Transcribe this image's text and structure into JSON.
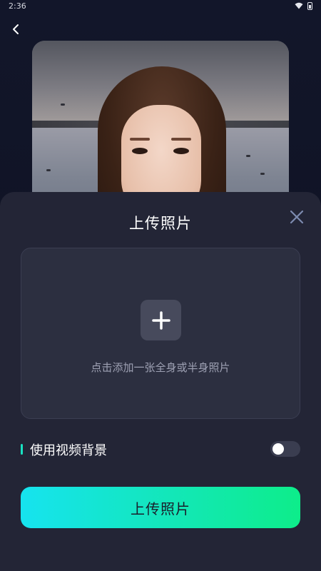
{
  "status_bar": {
    "time": "2:36"
  },
  "icons": {
    "back": "chevron-left-icon",
    "close": "close-icon",
    "add": "plus-icon",
    "wifi": "wifi-icon",
    "battery": "battery-icon"
  },
  "sheet": {
    "title": "上传照片",
    "upload_hint": "点击添加一张全身或半身照片",
    "toggle_label": "使用视频背景",
    "toggle_on": false,
    "submit_label": "上传照片"
  },
  "colors": {
    "accent": "#19e2c2",
    "button_gradient_start": "#16e3ef",
    "button_gradient_end": "#0ded8a",
    "sheet_background": "#232536"
  }
}
